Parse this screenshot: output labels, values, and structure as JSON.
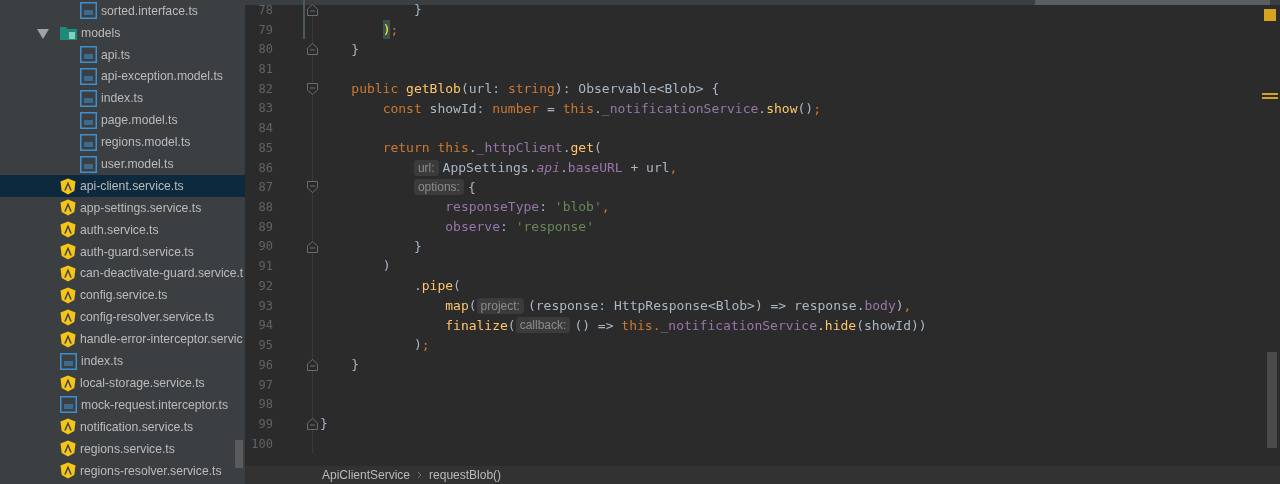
{
  "project_tree": [
    {
      "kind": "folder-continued",
      "children": [
        {
          "kind": "ts",
          "name": "sorted.interface.ts",
          "selected": false
        }
      ]
    },
    {
      "kind": "folder",
      "name": "models",
      "expanded": true,
      "selected": false,
      "children": [
        {
          "kind": "ts",
          "name": "api.ts",
          "selected": false
        },
        {
          "kind": "ts",
          "name": "api-exception.model.ts",
          "selected": false
        },
        {
          "kind": "ts",
          "name": "index.ts",
          "selected": false
        },
        {
          "kind": "ts",
          "name": "page.model.ts",
          "selected": false
        },
        {
          "kind": "ts",
          "name": "regions.model.ts",
          "selected": false
        },
        {
          "kind": "ts",
          "name": "user.model.ts",
          "selected": false
        }
      ]
    },
    {
      "kind": "angular",
      "name": "api-client.service.ts",
      "selected": true
    },
    {
      "kind": "angular",
      "name": "app-settings.service.ts",
      "selected": false
    },
    {
      "kind": "angular",
      "name": "auth.service.ts",
      "selected": false
    },
    {
      "kind": "angular",
      "name": "auth-guard.service.ts",
      "selected": false
    },
    {
      "kind": "angular",
      "name": "can-deactivate-guard.service.t",
      "selected": false
    },
    {
      "kind": "angular",
      "name": "config.service.ts",
      "selected": false
    },
    {
      "kind": "angular",
      "name": "config-resolver.service.ts",
      "selected": false
    },
    {
      "kind": "angular",
      "name": "handle-error-interceptor.servic",
      "selected": false
    },
    {
      "kind": "ts",
      "name": "index.ts",
      "selected": false
    },
    {
      "kind": "angular",
      "name": "local-storage.service.ts",
      "selected": false
    },
    {
      "kind": "ts",
      "name": "mock-request.interceptor.ts",
      "selected": false
    },
    {
      "kind": "angular",
      "name": "notification.service.ts",
      "selected": false
    },
    {
      "kind": "angular",
      "name": "regions.service.ts",
      "selected": false
    },
    {
      "kind": "angular",
      "name": "regions-resolver.service.ts",
      "selected": false
    }
  ],
  "editor": {
    "lines": [
      {
        "number": "78",
        "fold_start": false,
        "fold_end": true,
        "changed": true,
        "tokens": [
          {
            "kind": "plain",
            "text": "            }"
          }
        ]
      },
      {
        "number": "79",
        "fold_start": false,
        "fold_end": false,
        "changed": true,
        "tokens": [
          {
            "kind": "match",
            "text": "        )"
          },
          {
            "kind": "keyword",
            "text": ";"
          }
        ]
      },
      {
        "number": "80",
        "fold_start": false,
        "fold_end": true,
        "changed": false,
        "tokens": [
          {
            "kind": "plain",
            "text": "    }"
          }
        ]
      },
      {
        "number": "81",
        "fold_start": false,
        "fold_end": false,
        "changed": false
      },
      {
        "number": "82",
        "fold_start": true,
        "fold_end": false,
        "changed": false,
        "tokens": [
          {
            "kind": "keyword",
            "text": "    public"
          },
          {
            "kind": "function",
            "text": " getBlob"
          },
          {
            "kind": "plain",
            "text": "(url: "
          },
          {
            "kind": "keyword",
            "text": "string"
          },
          {
            "kind": "plain",
            "text": "): Observable<Blob> {"
          }
        ]
      },
      {
        "number": "83",
        "fold_start": false,
        "fold_end": false,
        "changed": false,
        "tokens": [
          {
            "kind": "keyword",
            "text": "        const"
          },
          {
            "kind": "plain",
            "text": " showId: "
          },
          {
            "kind": "keyword",
            "text": "number"
          },
          {
            "kind": "plain",
            "text": " = "
          },
          {
            "kind": "keyword",
            "text": "this"
          },
          {
            "kind": "plain",
            "text": "."
          },
          {
            "kind": "field",
            "text": "_notificationService"
          },
          {
            "kind": "plain",
            "text": "."
          },
          {
            "kind": "function",
            "text": "show"
          },
          {
            "kind": "plain",
            "text": "()"
          },
          {
            "kind": "keyword",
            "text": ";"
          }
        ]
      },
      {
        "number": "84",
        "fold_start": false,
        "fold_end": false,
        "changed": false
      },
      {
        "number": "85",
        "fold_start": false,
        "fold_end": false,
        "changed": false,
        "tokens": [
          {
            "kind": "keyword",
            "text": "        return"
          },
          {
            "kind": "keyword",
            "text": " this"
          },
          {
            "kind": "plain",
            "text": "."
          },
          {
            "kind": "field",
            "text": "_httpClient"
          },
          {
            "kind": "plain",
            "text": "."
          },
          {
            "kind": "function",
            "text": "get"
          },
          {
            "kind": "plain",
            "text": "("
          }
        ]
      },
      {
        "number": "86",
        "fold_start": false,
        "fold_end": false,
        "changed": false,
        "tokens": [
          {
            "kind": "hint",
            "text": "            url:"
          },
          {
            "kind": "plain",
            "text": "AppSettings."
          },
          {
            "kind": "static",
            "text": "api"
          },
          {
            "kind": "plain",
            "text": "."
          },
          {
            "kind": "field",
            "text": "baseURL"
          },
          {
            "kind": "plain",
            "text": " + url"
          },
          {
            "kind": "keyword",
            "text": ","
          }
        ]
      },
      {
        "number": "87",
        "fold_start": true,
        "fold_end": false,
        "changed": false,
        "tokens": [
          {
            "kind": "hint",
            "text": "            options:"
          },
          {
            "kind": "plain",
            "text": "{"
          }
        ]
      },
      {
        "number": "88",
        "fold_start": false,
        "fold_end": false,
        "changed": false,
        "tokens": [
          {
            "kind": "field",
            "text": "                responseType"
          },
          {
            "kind": "plain",
            "text": ": "
          },
          {
            "kind": "string",
            "text": "'blob'"
          },
          {
            "kind": "keyword",
            "text": ","
          }
        ]
      },
      {
        "number": "89",
        "fold_start": false,
        "fold_end": false,
        "changed": false,
        "tokens": [
          {
            "kind": "field",
            "text": "                observe"
          },
          {
            "kind": "plain",
            "text": ": "
          },
          {
            "kind": "string",
            "text": "'response'"
          }
        ]
      },
      {
        "number": "90",
        "fold_start": false,
        "fold_end": true,
        "changed": false,
        "tokens": [
          {
            "kind": "plain",
            "text": "            }"
          }
        ]
      },
      {
        "number": "91",
        "fold_start": false,
        "fold_end": false,
        "changed": false,
        "tokens": [
          {
            "kind": "plain",
            "text": "        )"
          }
        ]
      },
      {
        "number": "92",
        "fold_start": false,
        "fold_end": false,
        "changed": false,
        "tokens": [
          {
            "kind": "plain",
            "text": "            ."
          },
          {
            "kind": "function",
            "text": "pipe"
          },
          {
            "kind": "plain",
            "text": "("
          }
        ]
      },
      {
        "number": "93",
        "fold_start": false,
        "fold_end": false,
        "changed": false,
        "tokens": [
          {
            "kind": "function",
            "text": "                map"
          },
          {
            "kind": "plain",
            "text": "("
          },
          {
            "kind": "hint",
            "text": "project:"
          },
          {
            "kind": "plain",
            "text": "(response: HttpResponse<Blob>) => response."
          },
          {
            "kind": "field",
            "text": "body"
          },
          {
            "kind": "plain",
            "text": ")"
          },
          {
            "kind": "keyword",
            "text": ","
          }
        ]
      },
      {
        "number": "94",
        "fold_start": false,
        "fold_end": false,
        "changed": false,
        "tokens": [
          {
            "kind": "function",
            "text": "                finalize"
          },
          {
            "kind": "plain",
            "text": "("
          },
          {
            "kind": "hint",
            "text": "callback:"
          },
          {
            "kind": "plain",
            "text": "() => "
          },
          {
            "kind": "keyword",
            "text": "this."
          },
          {
            "kind": "field",
            "text": "_notificationService"
          },
          {
            "kind": "function",
            "text": ".hide"
          },
          {
            "kind": "plain",
            "text": "(showId))"
          }
        ]
      },
      {
        "number": "95",
        "fold_start": false,
        "fold_end": false,
        "changed": false,
        "tokens": [
          {
            "kind": "plain",
            "text": "            )"
          },
          {
            "kind": "keyword",
            "text": ";"
          }
        ]
      },
      {
        "number": "96",
        "fold_start": false,
        "fold_end": true,
        "changed": false,
        "tokens": [
          {
            "kind": "plain",
            "text": "    }"
          }
        ]
      },
      {
        "number": "97",
        "fold_start": false,
        "fold_end": false,
        "changed": false
      },
      {
        "number": "98",
        "fold_start": false,
        "fold_end": false,
        "changed": false
      },
      {
        "number": "99",
        "fold_start": false,
        "fold_end": true,
        "changed": false,
        "tokens": [
          {
            "kind": "plain",
            "text": "}"
          }
        ]
      },
      {
        "number": "100",
        "fold_start": false,
        "fold_end": false,
        "changed": false
      }
    ]
  },
  "breadcrumbs": [
    "ApiClientService",
    "requestBlob()"
  ]
}
